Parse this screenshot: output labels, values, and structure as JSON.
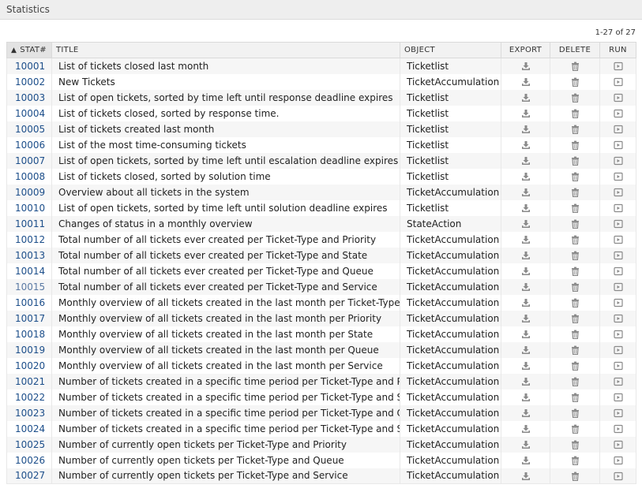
{
  "header": {
    "title": "Statistics"
  },
  "pager": {
    "text": "1-27 of 27"
  },
  "columns": {
    "stat": "STAT#",
    "title": "TITLE",
    "object": "OBJECT",
    "export": "EXPORT",
    "delete": "DELETE",
    "run": "RUN"
  },
  "sort_indicator": "▲",
  "icons": {
    "export": "download-icon",
    "delete": "trash-icon",
    "run": "play-icon"
  },
  "colors": {
    "link": "#1c4e8a",
    "row_alt": "#f6f6f6",
    "header_bg": "#eeeeee"
  },
  "rows": [
    {
      "id": "10001",
      "title": "List of tickets closed last month",
      "object": "Ticketlist"
    },
    {
      "id": "10002",
      "title": "New Tickets",
      "object": "TicketAccumulation"
    },
    {
      "id": "10003",
      "title": "List of open tickets, sorted by time left until response deadline expires",
      "object": "Ticketlist"
    },
    {
      "id": "10004",
      "title": "List of tickets closed, sorted by response time.",
      "object": "Ticketlist"
    },
    {
      "id": "10005",
      "title": "List of tickets created last month",
      "object": "Ticketlist"
    },
    {
      "id": "10006",
      "title": "List of the most time-consuming tickets",
      "object": "Ticketlist"
    },
    {
      "id": "10007",
      "title": "List of open tickets, sorted by time left until escalation deadline expires",
      "object": "Ticketlist"
    },
    {
      "id": "10008",
      "title": "List of tickets closed, sorted by solution time",
      "object": "Ticketlist"
    },
    {
      "id": "10009",
      "title": "Overview about all tickets in the system",
      "object": "TicketAccumulation"
    },
    {
      "id": "10010",
      "title": "List of open tickets, sorted by time left until solution deadline expires",
      "object": "Ticketlist"
    },
    {
      "id": "10011",
      "title": "Changes of status in a monthly overview",
      "object": "StateAction"
    },
    {
      "id": "10012",
      "title": "Total number of all tickets ever created per Ticket-Type and Priority",
      "object": "TicketAccumulation"
    },
    {
      "id": "10013",
      "title": "Total number of all tickets ever created per Ticket-Type and State",
      "object": "TicketAccumulation"
    },
    {
      "id": "10014",
      "title": "Total number of all tickets ever created per Ticket-Type and Queue",
      "object": "TicketAccumulation"
    },
    {
      "id": "10015",
      "title": "Total number of all tickets ever created per Ticket-Type and Service",
      "object": "TicketAccumulation",
      "visited": true
    },
    {
      "id": "10016",
      "title": "Monthly overview of all tickets created in the last month per Ticket-Type",
      "object": "TicketAccumulation"
    },
    {
      "id": "10017",
      "title": "Monthly overview of all tickets created in the last month per Priority",
      "object": "TicketAccumulation"
    },
    {
      "id": "10018",
      "title": "Monthly overview of all tickets created in the last month per State",
      "object": "TicketAccumulation"
    },
    {
      "id": "10019",
      "title": "Monthly overview of all tickets created in the last month per Queue",
      "object": "TicketAccumulation"
    },
    {
      "id": "10020",
      "title": "Monthly overview of all tickets created in the last month per Service",
      "object": "TicketAccumulation"
    },
    {
      "id": "10021",
      "title": "Number of tickets created in a specific time period per Ticket-Type and Priority",
      "object": "TicketAccumulation"
    },
    {
      "id": "10022",
      "title": "Number of tickets created in a specific time period per Ticket-Type and State",
      "object": "TicketAccumulation"
    },
    {
      "id": "10023",
      "title": "Number of tickets created in a specific time period per Ticket-Type and Queue",
      "object": "TicketAccumulation"
    },
    {
      "id": "10024",
      "title": "Number of tickets created in a specific time period per Ticket-Type and Service",
      "object": "TicketAccumulation"
    },
    {
      "id": "10025",
      "title": "Number of currently open tickets per Ticket-Type and Priority",
      "object": "TicketAccumulation"
    },
    {
      "id": "10026",
      "title": "Number of currently open tickets per Ticket-Type and Queue",
      "object": "TicketAccumulation"
    },
    {
      "id": "10027",
      "title": "Number of currently open tickets per Ticket-Type and Service",
      "object": "TicketAccumulation"
    }
  ]
}
